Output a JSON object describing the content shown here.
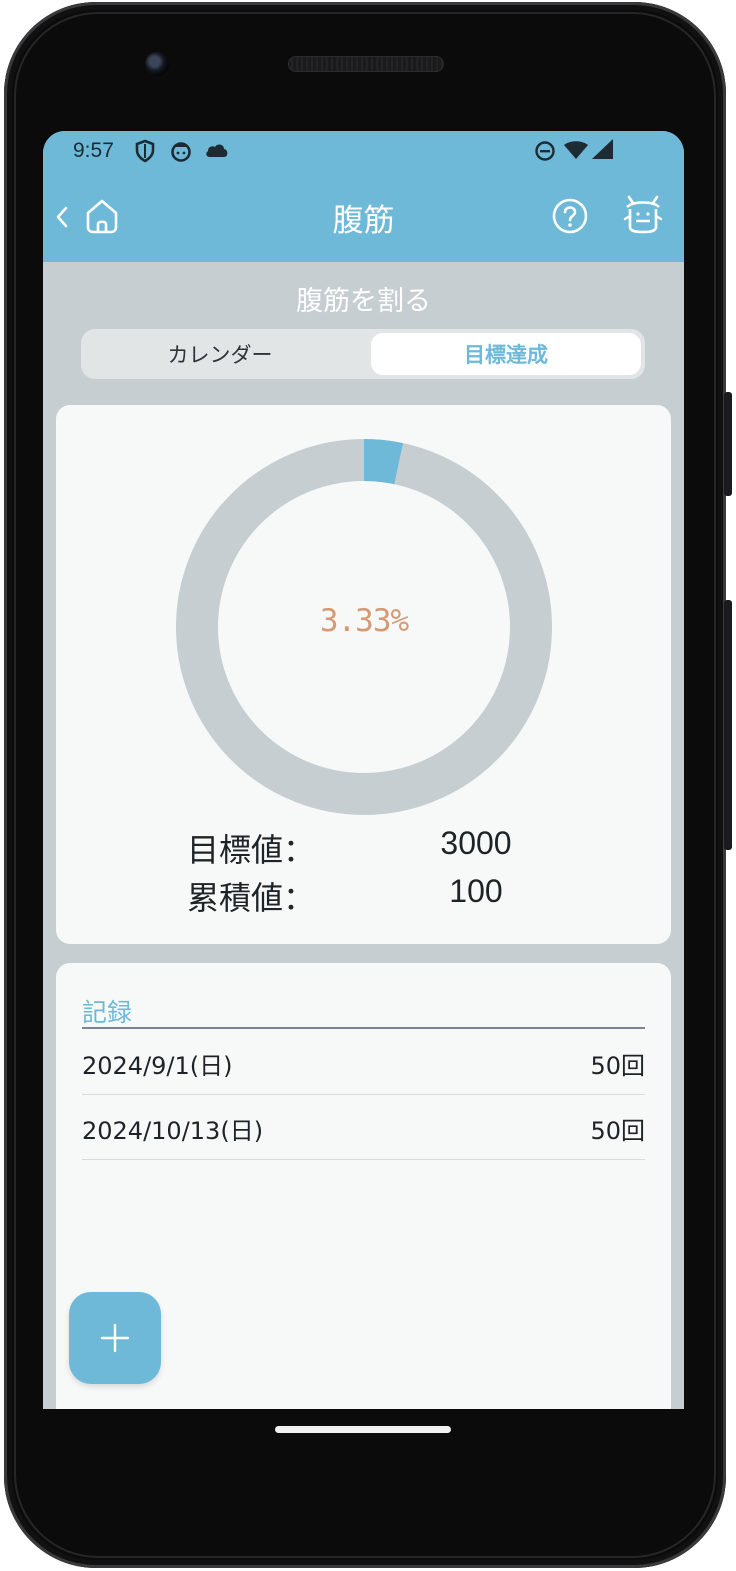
{
  "status_bar": {
    "time": "9:57",
    "left_icons": [
      "shield-icon",
      "face-icon",
      "cloud-icon"
    ],
    "right_icons": [
      "do-not-disturb-icon",
      "wifi-icon",
      "signal-icon"
    ]
  },
  "app_bar": {
    "title": "腹筋",
    "left_icons": [
      "back-chevron-icon",
      "home-icon"
    ],
    "right_icons": [
      "help-icon",
      "character-icon"
    ]
  },
  "goal": {
    "title": "腹筋を割る",
    "tabs": [
      {
        "label": "カレンダー",
        "active": false
      },
      {
        "label": "目標達成",
        "active": true
      }
    ],
    "progress_label": "3.33%",
    "progress_fraction": 0.0333,
    "stats": [
      {
        "label": "目標値：",
        "value": "3000"
      },
      {
        "label": "累積値：",
        "value": "100"
      }
    ]
  },
  "records": {
    "heading": "記録",
    "items": [
      {
        "date": "2024/9/1(日)",
        "count": "50回"
      },
      {
        "date": "2024/10/13(日)",
        "count": "50回"
      }
    ]
  },
  "fab": {
    "icon": "plus-icon"
  },
  "colors": {
    "accent": "#6eb9d7",
    "background": "#c6ced1",
    "card": "#f7f9f9",
    "progress_text": "#d49a73",
    "donut_track": "#c6ced1"
  }
}
